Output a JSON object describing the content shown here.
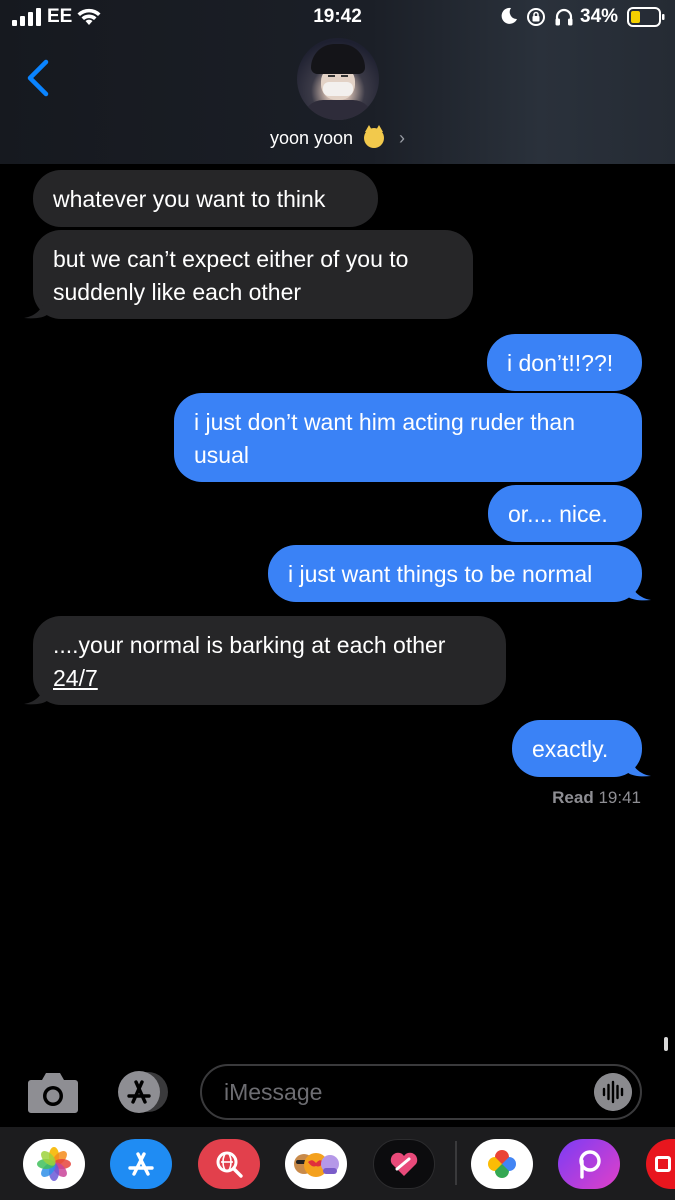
{
  "status_bar": {
    "carrier": "EE",
    "time": "19:42",
    "battery_percent": "34%"
  },
  "header": {
    "contact_name": "yoon yoon",
    "contact_emoji": "cat-face-emoji"
  },
  "messages": [
    {
      "direction": "incoming",
      "text": "whatever you want to think"
    },
    {
      "direction": "incoming",
      "lines": [
        "but we can’t expect either of you to",
        "suddenly like each other"
      ]
    },
    {
      "direction": "outgoing",
      "text": "i don’t!!??!"
    },
    {
      "direction": "outgoing",
      "lines": [
        "i just don’t want him acting ruder than",
        "usual"
      ]
    },
    {
      "direction": "outgoing",
      "text": "or.... nice."
    },
    {
      "direction": "outgoing",
      "text": "i just want things to be normal"
    },
    {
      "direction": "incoming",
      "lines": [
        "....your normal is barking at each other",
        "24/7"
      ]
    },
    {
      "direction": "outgoing",
      "text": "exactly."
    }
  ],
  "read_receipt": {
    "label": "Read",
    "time": "19:41"
  },
  "composer": {
    "placeholder": "iMessage"
  },
  "app_drawer": [
    "photos-icon",
    "app-store-icon",
    "web-search-icon",
    "memoji-icon",
    "heart-sticker-icon",
    "google-photos-icon",
    "picsart-icon",
    "partial-app-icon"
  ],
  "colors": {
    "outgoing_bubble": "#3a82f6",
    "incoming_bubble": "#262628",
    "accent": "#0a84ff",
    "background": "#000000"
  }
}
